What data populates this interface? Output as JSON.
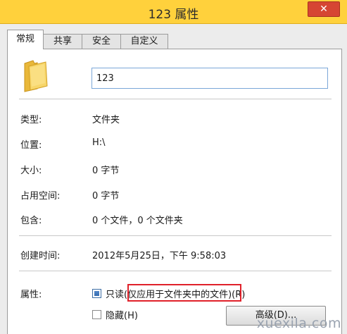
{
  "window": {
    "title": "123 属性",
    "close_glyph": "✕"
  },
  "tabs": [
    {
      "label": "常规",
      "active": true
    },
    {
      "label": "共享",
      "active": false
    },
    {
      "label": "安全",
      "active": false
    },
    {
      "label": "自定义",
      "active": false
    }
  ],
  "general": {
    "folder_icon": "folder-icon",
    "name_value": "123",
    "rows": [
      {
        "label": "类型:",
        "value": "文件夹"
      },
      {
        "label": "位置:",
        "value": "H:\\"
      },
      {
        "label": "大小:",
        "value": "0 字节"
      },
      {
        "label": "占用空间:",
        "value": "0 字节"
      },
      {
        "label": "包含:",
        "value": "0 个文件，0 个文件夹"
      }
    ],
    "created": {
      "label": "创建时间:",
      "value": "2012年5月25日，下午 9:58:03"
    },
    "attributes": {
      "label": "属性:",
      "readonly_label": "只读(仅应用于文件夹中的文件)(R)",
      "readonly_checked": true,
      "hidden_label": "隐藏(H)",
      "hidden_checked": false,
      "advanced_button": "高级(D)..."
    }
  },
  "colors": {
    "titlebar": "#ffd13c",
    "close_button": "#d64533",
    "highlight_box": "#e0212a",
    "input_border": "#7ba7d8"
  },
  "watermark": "xuexila.com"
}
